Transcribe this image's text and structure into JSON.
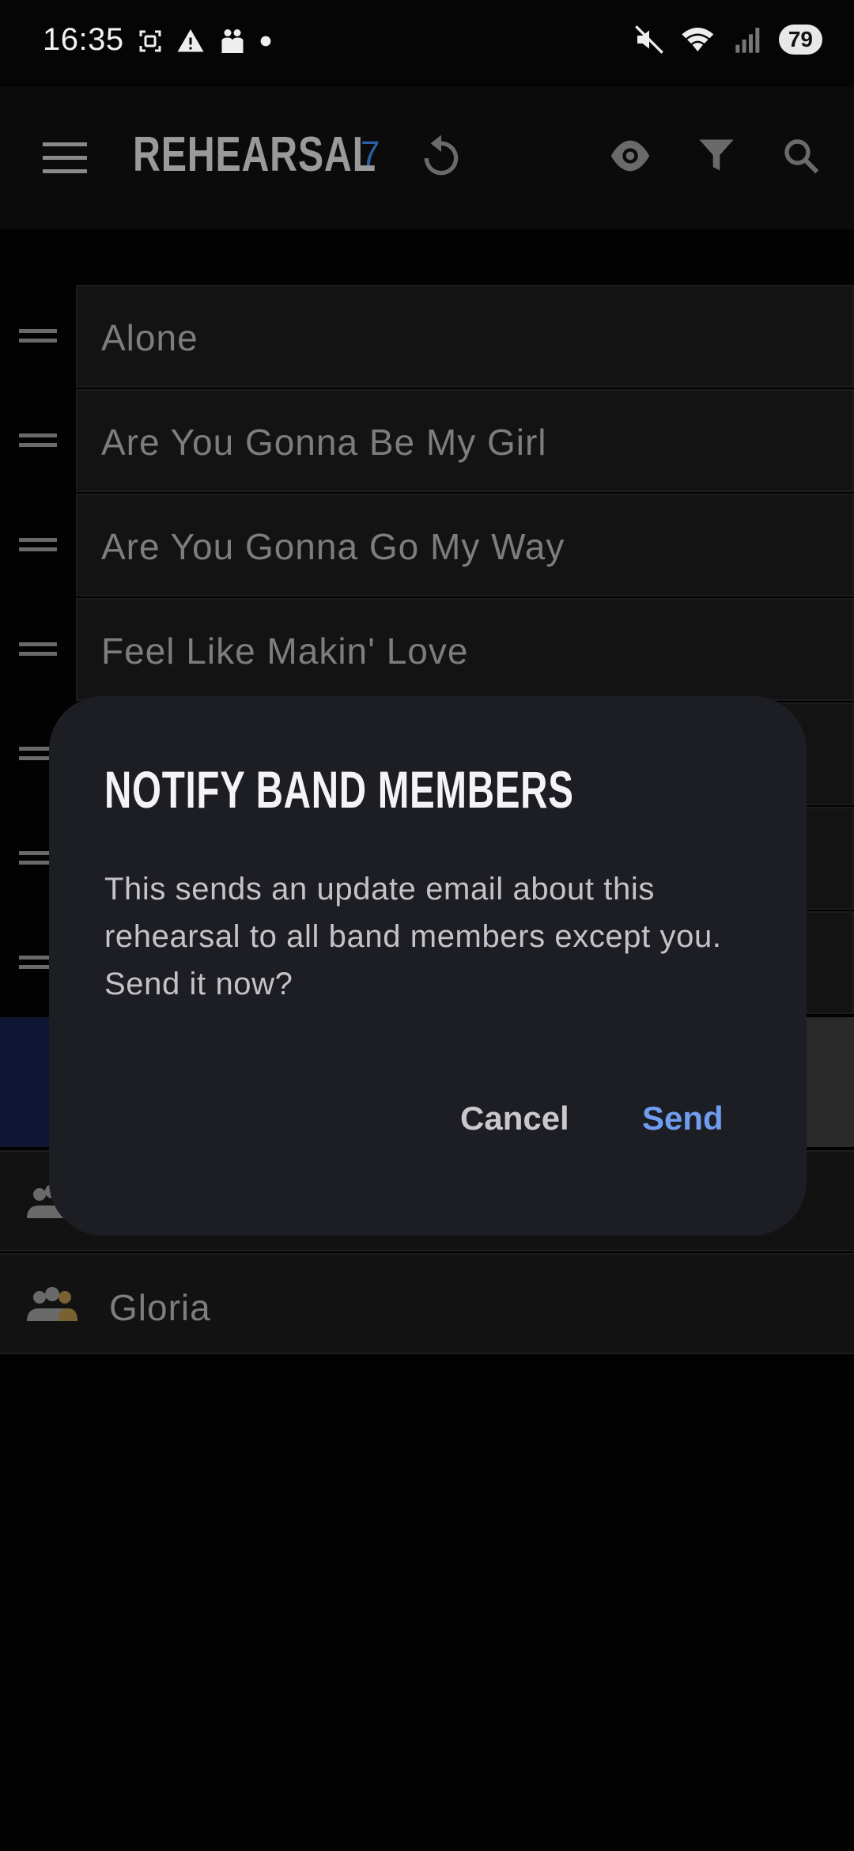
{
  "status_bar": {
    "time": "16:35",
    "battery": "79",
    "icons_left": [
      "screenshot-icon",
      "alert-icon",
      "people-icon",
      "dot-icon"
    ],
    "icons_right": [
      "mute-icon",
      "wifi-icon",
      "signal-icon"
    ]
  },
  "app_bar": {
    "title": "REHEARSAL",
    "count": "7",
    "icons": [
      "menu-icon",
      "refresh-icon",
      "eye-icon",
      "filter-icon",
      "search-icon"
    ]
  },
  "songs": [
    "Alone",
    "Are You Gonna Be My Girl",
    "Are You Gonna Go My Way",
    "Feel Like Makin' Love"
  ],
  "members": [
    "Gloria"
  ],
  "dialog": {
    "title": "NOTIFY BAND MEMBERS",
    "body": "This sends an update email about this rehearsal to all band members except you. Send it now?",
    "cancel_label": "Cancel",
    "send_label": "Send"
  },
  "colors": {
    "accent": "#6f9df0",
    "count": "#2d5fa8",
    "dialog_bg": "#1d1e24"
  }
}
